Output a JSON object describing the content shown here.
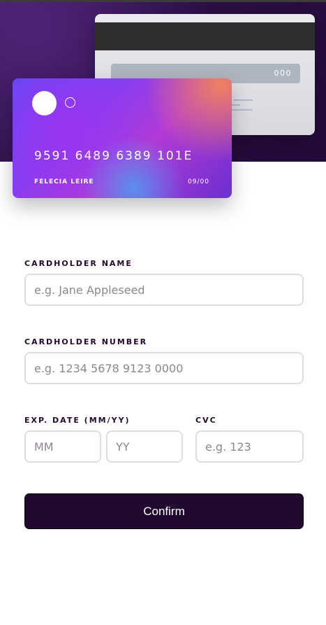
{
  "card_back": {
    "cvc": "000"
  },
  "card_front": {
    "number": "9591 6489 6389 101E",
    "name": "FELECIA LEIRE",
    "expiry": "09/00"
  },
  "form": {
    "name_label": "CARDHOLDER NAME",
    "name_placeholder": "e.g. Jane Appleseed",
    "number_label": "CARDHOLDER NUMBER",
    "number_placeholder": "e.g. 1234 5678 9123 0000",
    "exp_label": "EXP. DATE (MM/YY)",
    "month_placeholder": "MM",
    "year_placeholder": "YY",
    "cvc_label": "CVC",
    "cvc_placeholder": "e.g. 123",
    "confirm_label": "Confirm"
  },
  "colors": {
    "dark_violet": "#21092f",
    "border_gray": "#dedddf",
    "placeholder_gray": "#8e8593"
  }
}
